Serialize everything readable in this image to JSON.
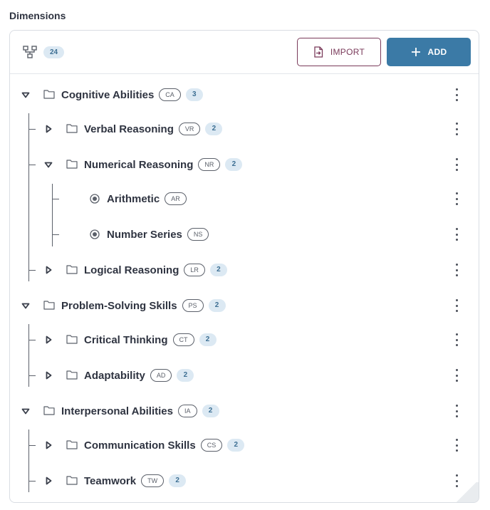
{
  "section_title": "Dimensions",
  "toolbar": {
    "tree_icon": "hierarchy-icon",
    "total_count": "24",
    "import_label": "IMPORT",
    "import_icon": "file-import-icon",
    "add_label": "ADD",
    "add_icon": "plus-icon"
  },
  "colors": {
    "accent": "#3b7aa6",
    "import_border": "#7a3a5a",
    "badge_bg": "#dce9f3",
    "badge_text": "#3d6f93"
  },
  "nodes": [
    {
      "label": "Cognitive Abilities",
      "code": "CA",
      "count": "3",
      "expanded": true,
      "type": "folder"
    },
    {
      "label": "Verbal Reasoning",
      "code": "VR",
      "count": "2",
      "expanded": false,
      "type": "folder"
    },
    {
      "label": "Numerical Reasoning",
      "code": "NR",
      "count": "2",
      "expanded": true,
      "type": "folder"
    },
    {
      "label": "Arithmetic",
      "code": "AR",
      "type": "leaf"
    },
    {
      "label": "Number Series",
      "code": "NS",
      "type": "leaf"
    },
    {
      "label": "Logical Reasoning",
      "code": "LR",
      "count": "2",
      "expanded": false,
      "type": "folder"
    },
    {
      "label": "Problem-Solving Skills",
      "code": "PS",
      "count": "2",
      "expanded": true,
      "type": "folder"
    },
    {
      "label": "Critical Thinking",
      "code": "CT",
      "count": "2",
      "expanded": false,
      "type": "folder"
    },
    {
      "label": "Adaptability",
      "code": "AD",
      "count": "2",
      "expanded": false,
      "type": "folder"
    },
    {
      "label": "Interpersonal Abilities",
      "code": "IA",
      "count": "2",
      "expanded": true,
      "type": "folder"
    },
    {
      "label": "Communication Skills",
      "code": "CS",
      "count": "2",
      "expanded": false,
      "type": "folder"
    },
    {
      "label": "Teamwork",
      "code": "TW",
      "count": "2",
      "expanded": false,
      "type": "folder"
    }
  ]
}
